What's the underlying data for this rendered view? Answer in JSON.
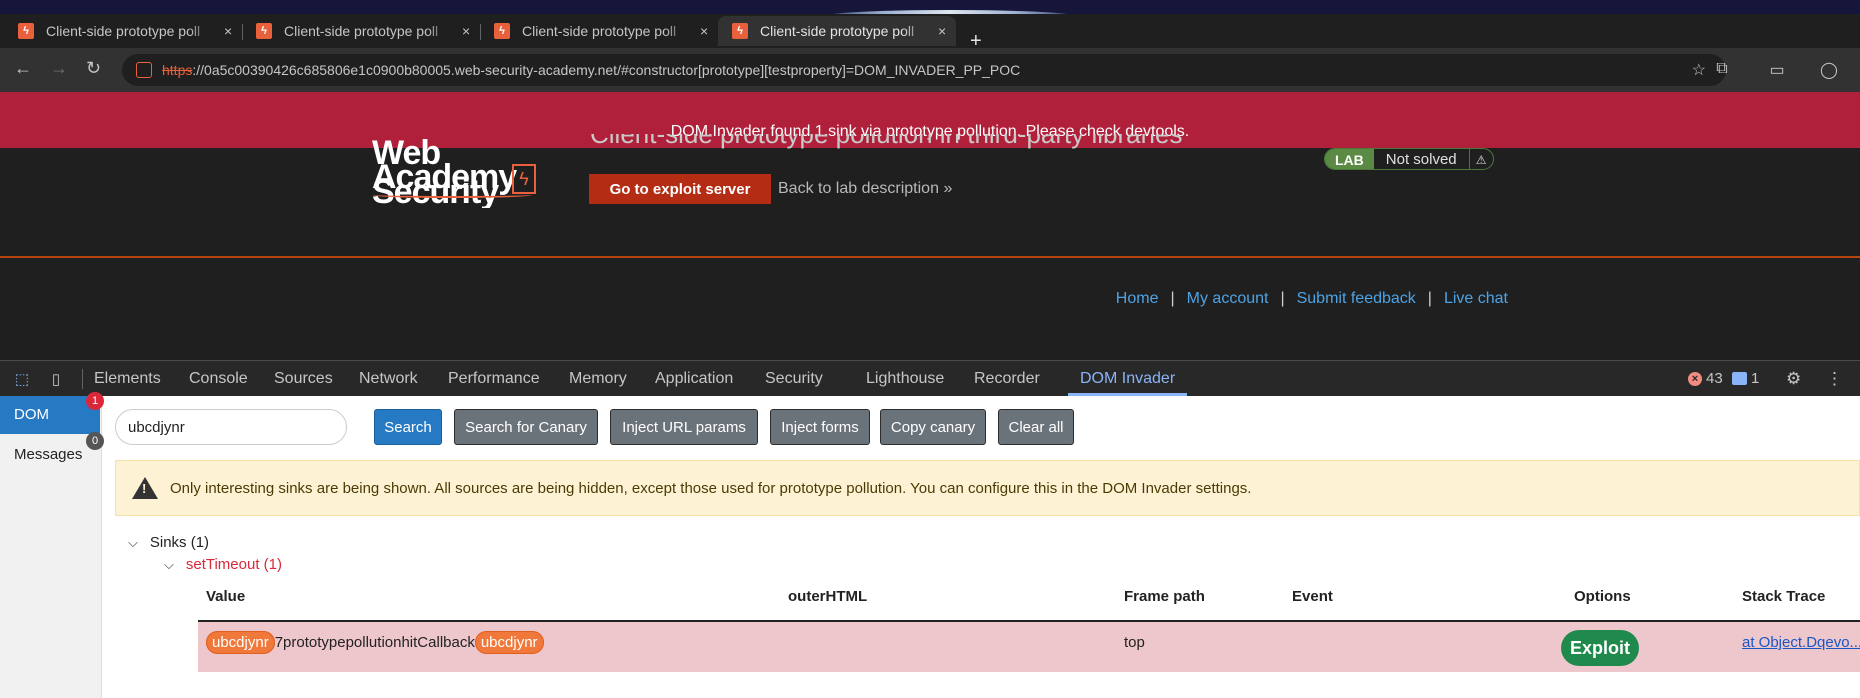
{
  "browser": {
    "tabs": [
      {
        "label": "Client-side prototype poll"
      },
      {
        "label": "Client-side prototype poll"
      },
      {
        "label": "Client-side prototype poll"
      },
      {
        "label": "Client-side prototype poll"
      }
    ],
    "close_glyph": "×",
    "newtab_glyph": "+",
    "url_scheme": "https",
    "url_rest": "://0a5c00390426c685806e1c0900b80005.web-security-academy.net/#constructor[prototype][testproperty]=DOM_INVADER_PP_POC"
  },
  "alert": {
    "text": "DOM Invader found 1 sink via prototype pollution. Please check devtools."
  },
  "site": {
    "logo_line1": "Web Security",
    "logo_line2": "Academy",
    "lab_title": "Client-side prototype pollution in third-party libraries",
    "exploit_server_label": "Go to exploit server",
    "back_label": "Back to lab description",
    "back_glyph": "»",
    "lab_badge": "LAB",
    "lab_status": "Not solved",
    "nav": {
      "home": "Home",
      "account": "My account",
      "feedback": "Submit feedback",
      "chat": "Live chat",
      "sep": "|"
    }
  },
  "devtools": {
    "tabs": [
      "Elements",
      "Console",
      "Sources",
      "Network",
      "Performance",
      "Memory",
      "Application",
      "Security",
      "Lighthouse",
      "Recorder",
      "DOM Invader"
    ],
    "active_tab": "DOM Invader",
    "error_count": "43",
    "message_count": "1"
  },
  "invader": {
    "sidebar": [
      {
        "label": "DOM",
        "badge": "1",
        "badge_color": "#d9283a"
      },
      {
        "label": "Messages",
        "badge": "0",
        "badge_color": "#555555"
      }
    ],
    "search_value": "ubcdjynr",
    "buttons": {
      "search": "Search",
      "search_canary": "Search for Canary",
      "inject_url": "Inject URL params",
      "inject_forms": "Inject forms",
      "copy_canary": "Copy canary",
      "clear_all": "Clear all"
    },
    "warning": "Only interesting sinks are being shown. All sources are being hidden, except those used for prototype pollution. You can configure this in the DOM Invader settings.",
    "sinks_label": "Sinks (1)",
    "sink_name": "setTimeout (1)",
    "columns": {
      "value": "Value",
      "outerhtml": "outerHTML",
      "frame": "Frame path",
      "event": "Event",
      "options": "Options",
      "stack": "Stack Trace"
    },
    "row": {
      "canary": "ubcdjynr",
      "value_middle": "7prototypepollutionhitCallback",
      "frame": "top",
      "exploit": "Exploit",
      "stack": "at Object.Dqevo..."
    }
  },
  "colors": {
    "accent": "#2679c3",
    "alert": "#b0203a",
    "exploit": "#b32c13",
    "row_highlight": "#eec7cc"
  }
}
